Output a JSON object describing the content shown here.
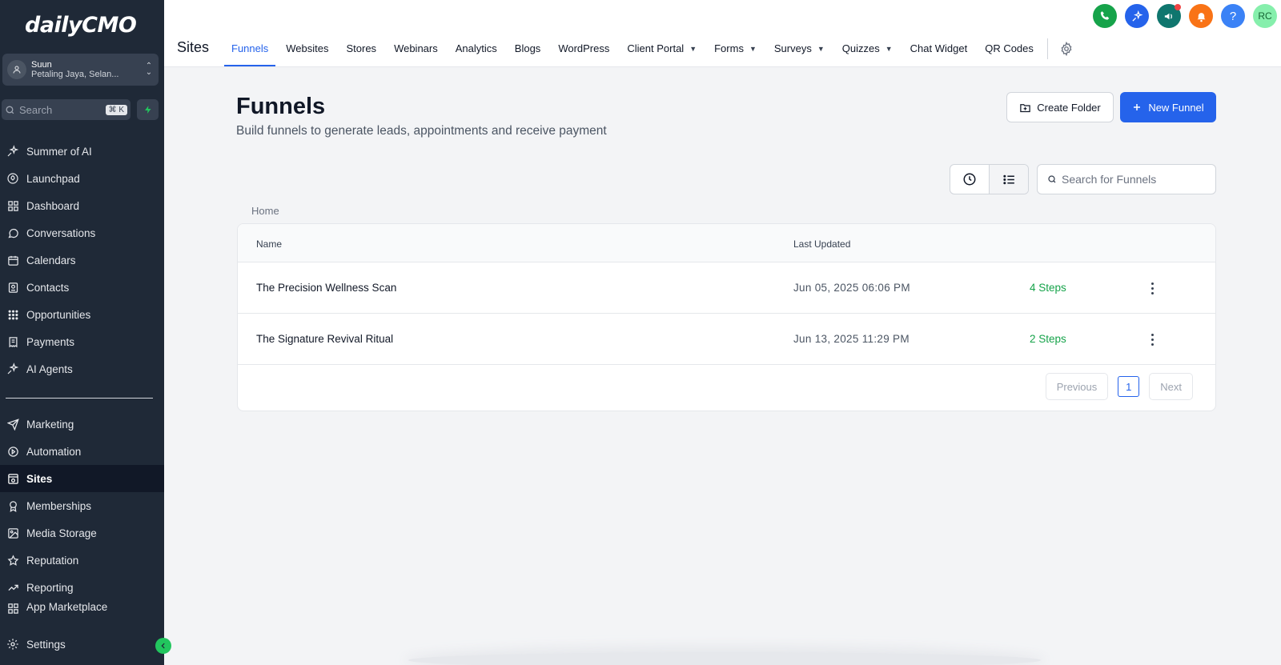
{
  "brand": {
    "logo": "dailyCMO"
  },
  "location": {
    "name": "Suun",
    "address": "Petaling Jaya, Selan..."
  },
  "sidebar": {
    "search_label": "Search",
    "search_shortcut": "⌘ K",
    "items": [
      {
        "label": "Summer of AI",
        "icon": "sparkle-icon"
      },
      {
        "label": "Launchpad",
        "icon": "rocket-icon"
      },
      {
        "label": "Dashboard",
        "icon": "grid-icon"
      },
      {
        "label": "Conversations",
        "icon": "chat-bubble-icon"
      },
      {
        "label": "Calendars",
        "icon": "calendar-icon"
      },
      {
        "label": "Contacts",
        "icon": "contacts-icon"
      },
      {
        "label": "Opportunities",
        "icon": "opportunities-icon"
      },
      {
        "label": "Payments",
        "icon": "receipt-icon"
      },
      {
        "label": "AI Agents",
        "icon": "sparkle-icon"
      },
      {
        "label": "Marketing",
        "icon": "send-icon"
      },
      {
        "label": "Automation",
        "icon": "automation-icon"
      },
      {
        "label": "Sites",
        "icon": "sites-icon"
      },
      {
        "label": "Memberships",
        "icon": "award-icon"
      },
      {
        "label": "Media Storage",
        "icon": "image-icon"
      },
      {
        "label": "Reputation",
        "icon": "star-icon"
      },
      {
        "label": "Reporting",
        "icon": "trending-up-icon"
      },
      {
        "label": "App Marketplace",
        "icon": "grid-icon"
      },
      {
        "label": "Settings",
        "icon": "gear-icon"
      }
    ]
  },
  "header": {
    "section_title": "Sites",
    "tabs": [
      {
        "label": "Funnels"
      },
      {
        "label": "Websites"
      },
      {
        "label": "Stores"
      },
      {
        "label": "Webinars"
      },
      {
        "label": "Analytics"
      },
      {
        "label": "Blogs"
      },
      {
        "label": "WordPress"
      },
      {
        "label": "Client Portal"
      },
      {
        "label": "Forms"
      },
      {
        "label": "Surveys"
      },
      {
        "label": "Quizzes"
      },
      {
        "label": "Chat Widget"
      },
      {
        "label": "QR Codes"
      }
    ],
    "active_tab": "Funnels",
    "user_initials": "RC"
  },
  "colors": {
    "accent": "#2563eb",
    "sidebar_bg": "#1f2937",
    "steps_green": "#16a34a"
  },
  "main": {
    "title": "Funnels",
    "subtitle": "Build funnels to generate leads, appointments and receive payment",
    "create_folder_label": "Create Folder",
    "new_funnel_label": "New Funnel",
    "search_placeholder": "Search for Funnels",
    "breadcrumb": "Home",
    "table": {
      "columns": [
        "Name",
        "Last Updated"
      ],
      "rows": [
        {
          "name": "The Precision Wellness Scan",
          "updated": "Jun 05, 2025 06:06 PM",
          "steps": "4 Steps"
        },
        {
          "name": "The Signature Revival Ritual",
          "updated": "Jun 13, 2025 11:29 PM",
          "steps": "2 Steps"
        }
      ]
    },
    "pagination": {
      "previous": "Previous",
      "page": "1",
      "next": "Next"
    }
  }
}
